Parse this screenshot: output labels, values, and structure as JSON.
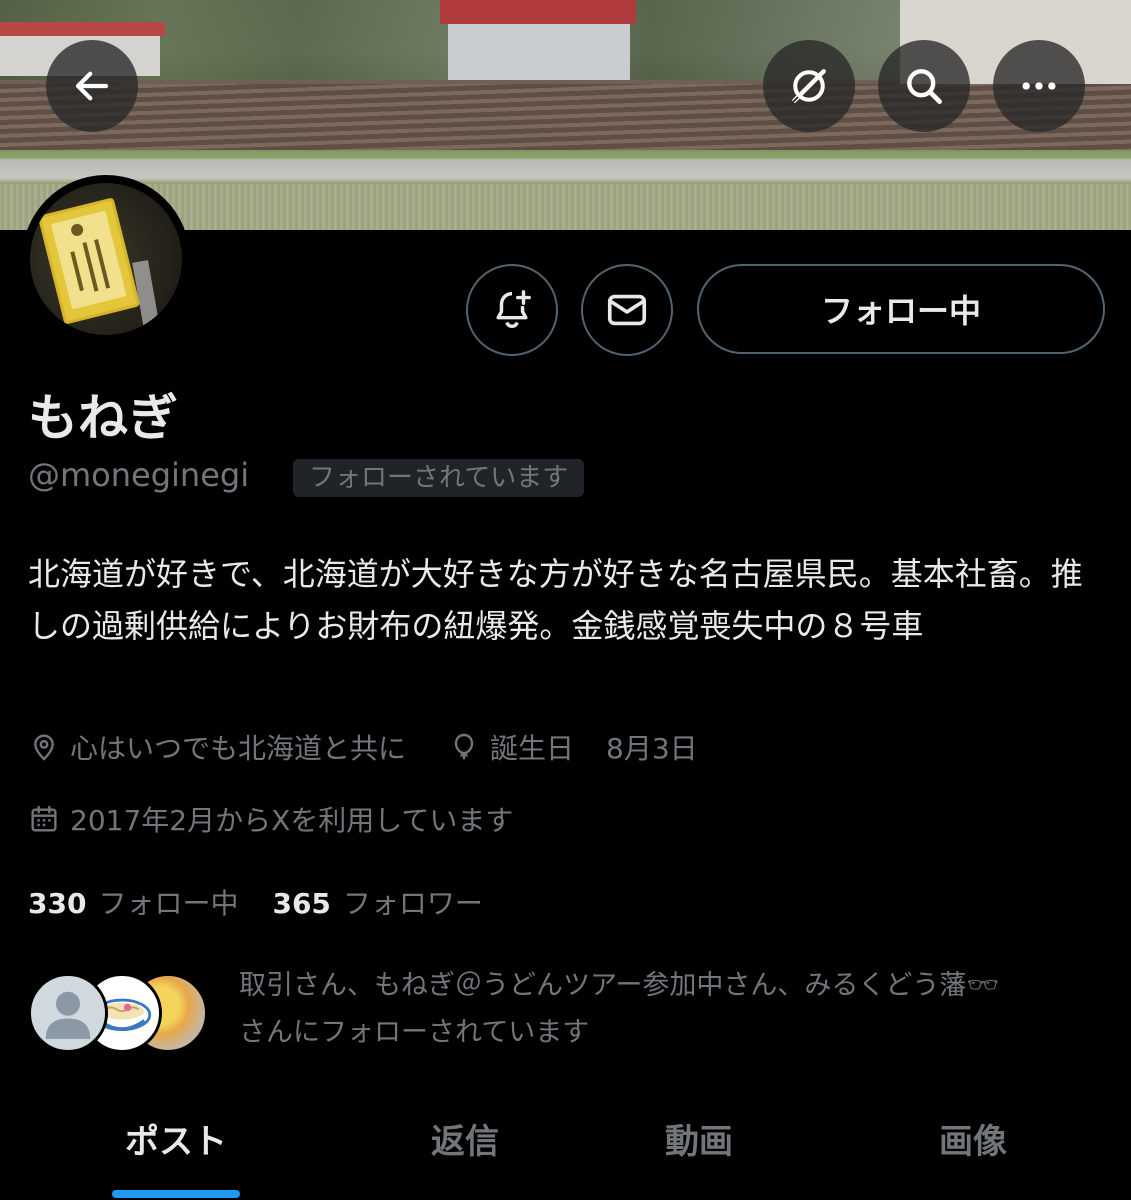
{
  "header": {
    "back_icon": "arrow-left-icon",
    "grok_icon": "grok-icon",
    "search_icon": "search-icon",
    "more_icon": "more-horizontal-icon"
  },
  "profile": {
    "name": "もねぎ",
    "handle": "@moneginegi",
    "follows_you_badge": "フォローされています",
    "bio": "北海道が好きで、北海道が大好きな方が好きな名古屋県民。基本社畜。推しの過剰供給によりお財布の紐爆発。金銭感覚喪失中の８号車",
    "location": "心はいつでも北海道と共に",
    "birthday_label": "誕生日",
    "birthday_value": "8月3日",
    "joined": "2017年2月からXを利用しています"
  },
  "actions": {
    "notify_icon": "bell-plus-icon",
    "message_icon": "mail-icon",
    "follow_label": "フォロー中"
  },
  "stats": {
    "following_count": "330",
    "following_label": "フォロー中",
    "followers_count": "365",
    "followers_label": "フォロワー"
  },
  "known_followers": {
    "text_line1": "取引さん、もねぎ＠うどんツアー参加中さん、みるくどう藩🕶️",
    "text_line2": "さんにフォローされています"
  },
  "tabs": [
    {
      "label": "ポスト",
      "active": true
    },
    {
      "label": "返信",
      "active": false
    },
    {
      "label": "動画",
      "active": false
    },
    {
      "label": "画像",
      "active": false
    }
  ],
  "colors": {
    "accent": "#1d9bf0",
    "background": "#000000",
    "muted_text": "#71767b",
    "primary_text": "#e7e9ea"
  }
}
